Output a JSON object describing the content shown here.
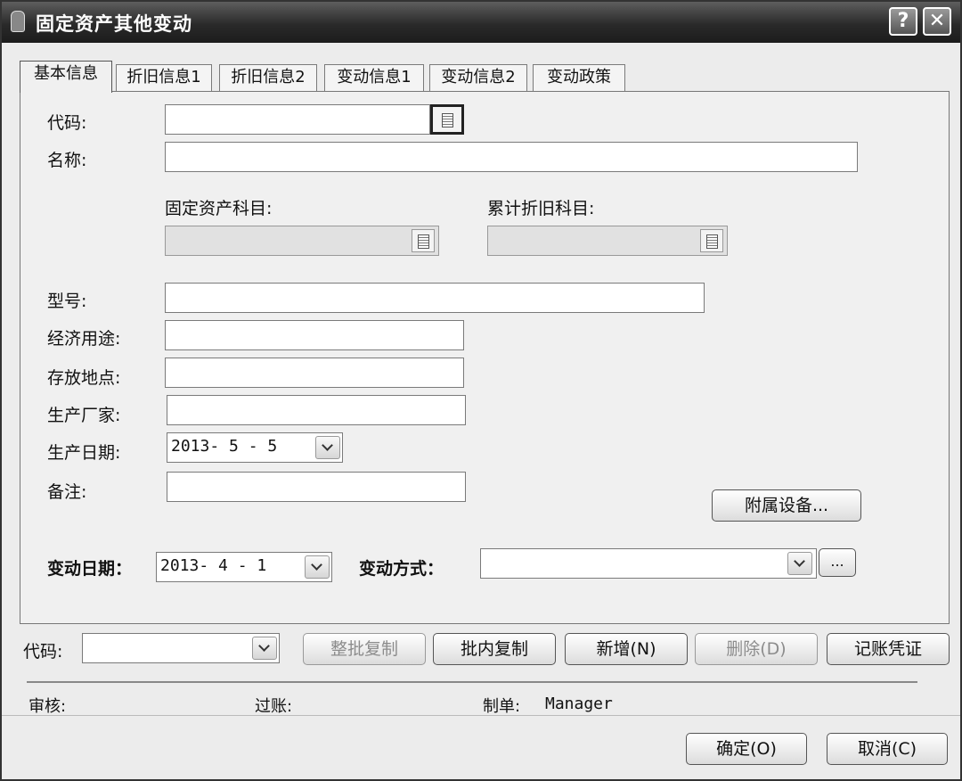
{
  "window": {
    "title": "固定资产其他变动",
    "help_label": "?",
    "close_label": "✕"
  },
  "tabs": [
    {
      "label": "基本信息"
    },
    {
      "label": "折旧信息1"
    },
    {
      "label": "折旧信息2"
    },
    {
      "label": "变动信息1"
    },
    {
      "label": "变动信息2"
    },
    {
      "label": "变动政策"
    }
  ],
  "form": {
    "code_label": "代码:",
    "code_value": "",
    "name_label": "名称:",
    "name_value": "",
    "asset_account_label": "固定资产科目:",
    "asset_account_value": "",
    "depr_account_label": "累计折旧科目:",
    "depr_account_value": "",
    "model_label": "型号:",
    "model_value": "",
    "usage_label": "经济用途:",
    "usage_value": "",
    "location_label": "存放地点:",
    "location_value": "",
    "manufacturer_label": "生产厂家:",
    "manufacturer_value": "",
    "prod_date_label": "生产日期:",
    "prod_date_value": "2013- 5 - 5",
    "remark_label": "备注:",
    "remark_value": "",
    "accessories_button": "附属设备...",
    "change_date_label": "变动日期：",
    "change_date_value": "2013- 4 - 1",
    "change_method_label": "变动方式：",
    "change_method_value": "",
    "ellipsis_button": "..."
  },
  "toolbar": {
    "code_label": "代码:",
    "code_value": "",
    "batch_copy": "整批复制",
    "inner_copy": "批内复制",
    "add": "新增(N)",
    "delete": "删除(D)",
    "voucher": "记账凭证"
  },
  "status": {
    "audit_label": "审核:",
    "posting_label": "过账:",
    "maker_label": "制单:",
    "maker_value": "Manager"
  },
  "footer": {
    "ok": "确定(O)",
    "cancel": "取消(C)"
  }
}
